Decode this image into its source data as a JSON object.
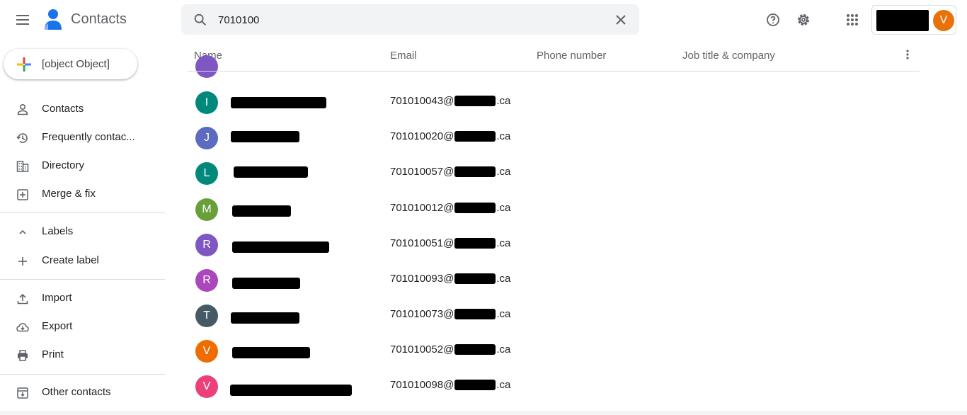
{
  "app": {
    "title": "Contacts",
    "brand_colors": {
      "blue": "#1a73e8",
      "red": "#ea4335",
      "yellow": "#fbbc04",
      "green": "#34a853"
    }
  },
  "search": {
    "value": "7010100",
    "clear_icon": "close-icon"
  },
  "header_actions": {
    "help_icon": "help-icon",
    "settings_icon": "gear-icon",
    "apps_icon": "apps-grid-icon"
  },
  "account": {
    "avatar_letter": "V",
    "avatar_color": "#e8710a"
  },
  "sidebar": {
    "create_label": {
      "label": "Create label",
      "icon": "plus-icon"
    },
    "items": [
      {
        "label": "Contacts",
        "icon": "person-icon"
      },
      {
        "label": "Frequently contac...",
        "icon": "history-icon"
      },
      {
        "label": "Directory",
        "icon": "building-icon"
      },
      {
        "label": "Merge & fix",
        "icon": "merge-icon"
      }
    ],
    "labels_section": {
      "label": "Labels",
      "icon": "chevron-up-icon"
    },
    "tools": [
      {
        "label": "Import",
        "icon": "upload-icon"
      },
      {
        "label": "Export",
        "icon": "cloud-download-icon"
      },
      {
        "label": "Print",
        "icon": "printer-icon"
      }
    ],
    "other": {
      "label": "Other contacts",
      "icon": "archive-icon"
    }
  },
  "table": {
    "columns": [
      "Name",
      "Email",
      "Phone number",
      "Job title & company"
    ],
    "rows": [
      {
        "letter": "I",
        "color": "#00897b",
        "email_prefix": "701010043@",
        "email_suffix": ".ca"
      },
      {
        "letter": "J",
        "color": "#5c6bc0",
        "email_prefix": "701010020@",
        "email_suffix": ".ca"
      },
      {
        "letter": "L",
        "color": "#00897b",
        "email_prefix": "701010057@",
        "email_suffix": ".ca"
      },
      {
        "letter": "M",
        "color": "#689f38",
        "email_prefix": "701010012@",
        "email_suffix": ".ca"
      },
      {
        "letter": "R",
        "color": "#7e57c2",
        "email_prefix": "701010051@",
        "email_suffix": ".ca"
      },
      {
        "letter": "R",
        "color": "#ab47bc",
        "email_prefix": "701010093@",
        "email_suffix": ".ca"
      },
      {
        "letter": "T",
        "color": "#455a64",
        "email_prefix": "701010073@",
        "email_suffix": ".ca"
      },
      {
        "letter": "V",
        "color": "#ef6c00",
        "email_prefix": "701010052@",
        "email_suffix": ".ca"
      },
      {
        "letter": "V",
        "color": "#ec407a",
        "email_prefix": "701010098@",
        "email_suffix": ".ca"
      }
    ]
  }
}
